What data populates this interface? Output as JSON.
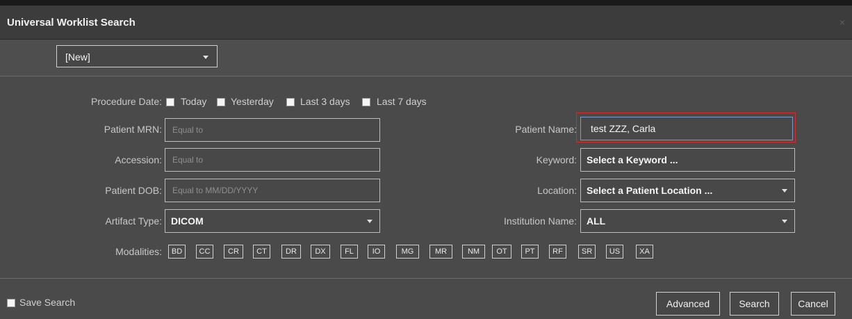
{
  "dialog": {
    "title": "Universal Worklist Search",
    "close": "×"
  },
  "preset": {
    "selected": "[New]"
  },
  "procedure_date": {
    "label": "Procedure Date:",
    "options": [
      "Today",
      "Yesterday",
      "Last 3 days",
      "Last 7 days"
    ]
  },
  "fields": {
    "mrn": {
      "label": "Patient MRN:",
      "placeholder": "Equal to"
    },
    "accession": {
      "label": "Accession:",
      "placeholder": "Equal to"
    },
    "dob": {
      "label": "Patient DOB:",
      "placeholder": "Equal to MM/DD/YYYY"
    },
    "artifact_type": {
      "label": "Artifact Type:",
      "value": "DICOM"
    },
    "patient_name": {
      "label": "Patient Name:",
      "value": "test ZZZ, Carla"
    },
    "keyword": {
      "label": "Keyword:",
      "value": "Select a Keyword ..."
    },
    "location": {
      "label": "Location:",
      "value": "Select a Patient Location ..."
    },
    "institution": {
      "label": "Institution Name:",
      "value": "ALL"
    }
  },
  "modalities": {
    "label": "Modalities:",
    "items": [
      "BD",
      "CC",
      "CR",
      "CT",
      "DR",
      "DX",
      "FL",
      "IO",
      "MG",
      "MR",
      "NM",
      "OT",
      "PT",
      "RF",
      "SR",
      "US",
      "XA"
    ]
  },
  "footer": {
    "save_search": "Save Search",
    "advanced": "Advanced",
    "search": "Search",
    "cancel": "Cancel"
  },
  "colors": {
    "highlight": "#e02828",
    "background": "#4a4a4a",
    "titlebar": "#3c3c3c"
  }
}
